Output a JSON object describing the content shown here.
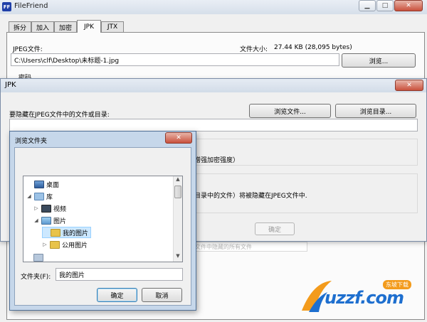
{
  "colors": {
    "window_bg": "#f0f0f0",
    "title_bar": "#dfe7f1",
    "folder": "#e8c34a",
    "selection": "#cce8ff",
    "logo_orange": "#f39b1c",
    "logo_blue": "#1e6fcf"
  },
  "main_window": {
    "title": "FileFriend",
    "app_icon": "FF",
    "caption": {
      "minimize": "▁",
      "maximize": "□",
      "close": "✕"
    },
    "tabs": [
      "拆分",
      "加入",
      "加密",
      "JPK",
      "JTX"
    ],
    "active_tab": "JPK",
    "jpeg_file_label": "JPEG文件:",
    "file_size_label": "文件大小:",
    "file_size_value": "27.44 KB (28,095 bytes)",
    "jpeg_path": "C:\\Users\\clf\\Desktop\\未标题-1.jpg",
    "browse_button": "浏览...",
    "partial_label": "密码"
  },
  "jpk_dialog": {
    "title": "JPK",
    "close": "✕",
    "hide_label": "要隐藏在JPEG文件中的文件或目录:",
    "browse_file_button": "浏览文件...",
    "browse_dir_button": "浏览目录...",
    "hide_path": "",
    "strength_text": "增强加密强度）",
    "hint_text": "目录中的文件）将被隐藏在JPEG文件中.",
    "ok_button": "确定"
  },
  "folder_dialog": {
    "title": "浏览文件夹",
    "close": "✕",
    "tree": [
      {
        "label": "桌面",
        "icon": "desktop-icon",
        "arrow": ""
      },
      {
        "label": "库",
        "icon": "library-icon",
        "arrow": "◢"
      },
      {
        "label": "视频",
        "icon": "video-library-icon",
        "arrow": "▷"
      },
      {
        "label": "图片",
        "icon": "pictures-library-icon",
        "arrow": "◢"
      },
      {
        "label": "我的图片",
        "icon": "folder-icon",
        "arrow": ""
      },
      {
        "label": "公用图片",
        "icon": "folder-icon",
        "arrow": "▷"
      }
    ],
    "folder_label": "文件夹(F):",
    "folder_value": "我的图片",
    "ok_button": "确定",
    "cancel_button": "取消"
  },
  "bottom_faded_text": "文件中隐藏的所有文件",
  "watermark": {
    "logo_text": "uzzf.com",
    "badge_text": "东坡下载"
  }
}
